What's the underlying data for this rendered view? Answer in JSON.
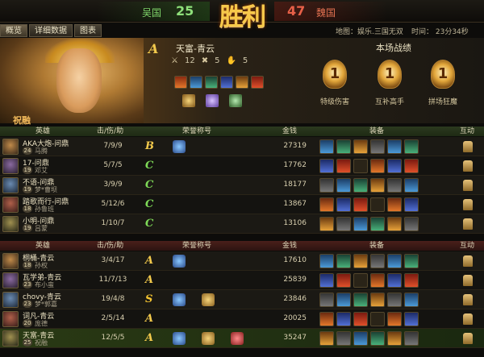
{
  "scoreboard": {
    "team_left": "吴国",
    "score_left": "25",
    "result": "胜利",
    "score_right": "47",
    "team_right": "魏国"
  },
  "tabs": [
    "概览",
    "详细数据",
    "图表"
  ],
  "match_info": {
    "map": "地图：娱乐.三国无双",
    "time": "时间： 23分34秒"
  },
  "mvp": {
    "grade": "A",
    "name": "天富-青云",
    "kills": "12",
    "deaths": "5",
    "assists": "5",
    "record_title": "本场战绩",
    "medals": [
      {
        "label": "特级伤害",
        "value": "1"
      },
      {
        "label": "互补高手",
        "value": "1"
      },
      {
        "label": "拼场狂魔",
        "value": "1"
      }
    ],
    "hero_name": "祝融"
  },
  "columns": {
    "hero": "英雄",
    "kda": "击/伤/助",
    "honor": "荣誉称号",
    "gold": "金钱",
    "equip": "装备",
    "interact": "互动"
  },
  "team_a": [
    {
      "name": "AKA大炮-问鼎",
      "level": "24",
      "hero": "马腾",
      "kda": "7/9/9",
      "grade": "B",
      "gold": "27319"
    },
    {
      "name": "17-问鼎",
      "level": "19",
      "hero": "邓艾",
      "kda": "5/7/5",
      "grade": "C",
      "gold": "17762"
    },
    {
      "name": "不语-问鼎",
      "level": "19",
      "hero": "梦*曹坝",
      "kda": "3/9/9",
      "grade": "C",
      "gold": "18177"
    },
    {
      "name": "踏歌而行-问鼎",
      "level": "18",
      "hero": "孙鲁班",
      "kda": "5/12/6",
      "grade": "C",
      "gold": "13867"
    },
    {
      "name": "小明-问鼎",
      "level": "19",
      "hero": "吕蒙",
      "kda": "1/10/7",
      "grade": "C",
      "gold": "13106"
    }
  ],
  "team_b": [
    {
      "name": "桐桶-青云",
      "level": "18",
      "hero": "孙权",
      "kda": "3/4/17",
      "grade": "A",
      "gold": "17610"
    },
    {
      "name": "瓦学弟-青云",
      "level": "23",
      "hero": "布小蛮",
      "kda": "11/7/13",
      "grade": "A",
      "gold": "25839"
    },
    {
      "name": "chovy-青云",
      "level": "23",
      "hero": "梦*郭嘉",
      "kda": "19/4/8",
      "grade": "S",
      "gold": "23846"
    },
    {
      "name": "词凡-青云",
      "level": "20",
      "hero": "庞德",
      "kda": "2/5/14",
      "grade": "A",
      "gold": "20025"
    },
    {
      "name": "天富-青云",
      "level": "25",
      "hero": "祝融",
      "kda": "12/5/5",
      "grade": "A",
      "gold": "35247"
    }
  ],
  "colors": {
    "grade_A": "#f2c94c",
    "grade_B": "#f2c94c",
    "grade_C": "#7ed957",
    "grade_S": "#f4c430",
    "team_win": "#7fd46a",
    "team_lose": "#e07050"
  }
}
